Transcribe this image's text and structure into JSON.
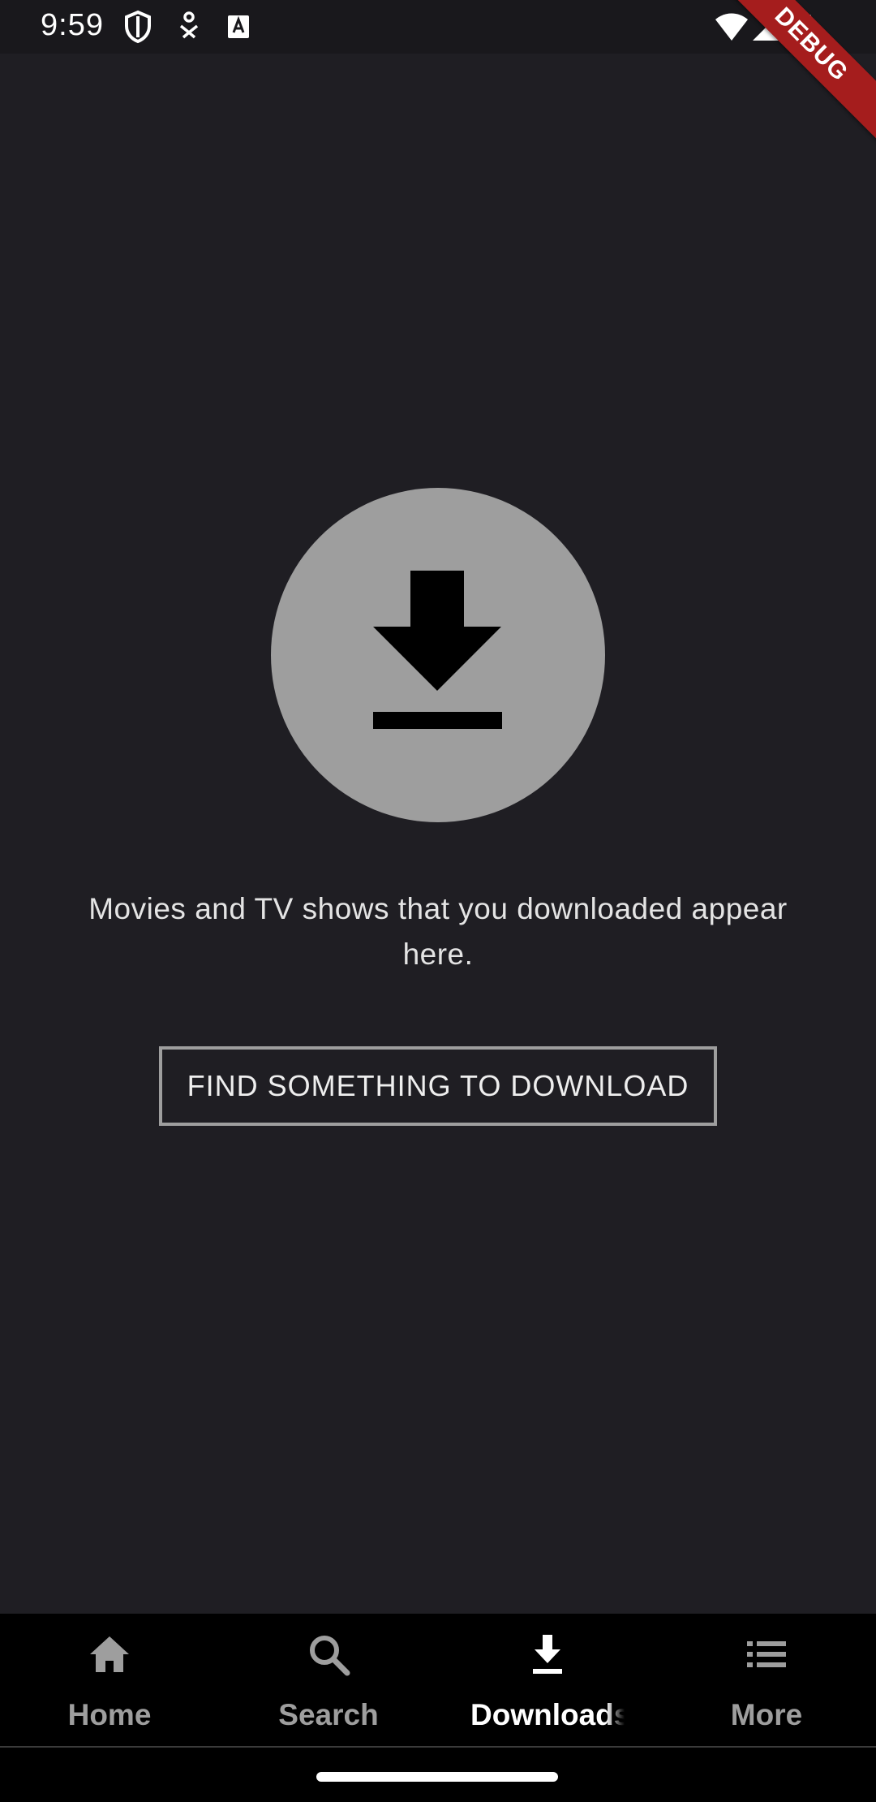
{
  "status_bar": {
    "time": "9:59",
    "left_icons": [
      "shield-icon",
      "accessibility-icon",
      "keyboard-a-icon"
    ],
    "right_icons": [
      "wifi-icon",
      "signal-icon",
      "battery-icon"
    ]
  },
  "debug_banner": {
    "label": "DEBUG",
    "color": "#a51d1d"
  },
  "empty_state": {
    "icon": "download-icon",
    "message": "Movies and TV shows that you downloaded appear here.",
    "button_label": "FIND SOMETHING TO DOWNLOAD",
    "circle_color": "#9e9e9e"
  },
  "bottom_nav": {
    "items": [
      {
        "label": "Home",
        "icon": "home-icon",
        "active": false
      },
      {
        "label": "Search",
        "icon": "search-icon",
        "active": false
      },
      {
        "label": "Downloads",
        "icon": "download-icon",
        "active": true
      },
      {
        "label": "More",
        "icon": "list-icon",
        "active": false
      }
    ],
    "active_color": "#ffffff",
    "inactive_color": "#9e9e9e"
  },
  "colors": {
    "background": "#1f1e23",
    "nav_background": "#000000"
  }
}
